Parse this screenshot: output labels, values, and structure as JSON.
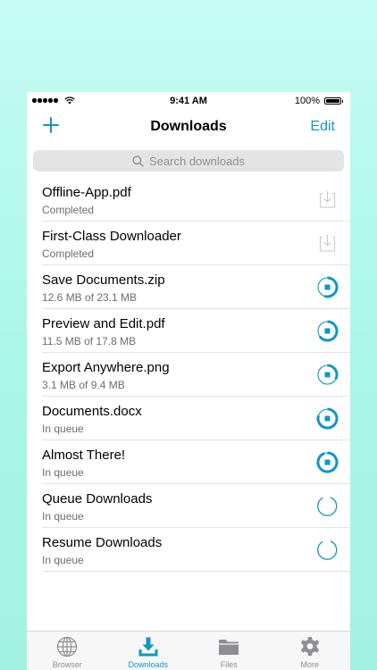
{
  "status": {
    "time": "9:41 AM",
    "battery": "100%"
  },
  "nav": {
    "title": "Downloads",
    "edit": "Edit"
  },
  "search": {
    "placeholder": "Search downloads"
  },
  "accent": "#1396c1",
  "rows": [
    {
      "title": "Offline-App.pdf",
      "subtitle": "Completed",
      "icon": "download-done-icon"
    },
    {
      "title": "First-Class Downloader",
      "subtitle": "Completed",
      "icon": "download-done-icon"
    },
    {
      "title": "Save Documents.zip",
      "subtitle": "12.6 MB of 23.1 MB",
      "icon": "progress-stop-icon",
      "progress": 0.55
    },
    {
      "title": "Preview and Edit.pdf",
      "subtitle": "11.5 MB of 17.8 MB",
      "icon": "progress-stop-icon",
      "progress": 0.65
    },
    {
      "title": "Export Anywhere.png",
      "subtitle": "3.1 MB of 9.4 MB",
      "icon": "progress-stop-icon",
      "progress": 0.33
    },
    {
      "title": "Documents.docx",
      "subtitle": "In queue",
      "icon": "progress-stop-icon",
      "progress": 0.8
    },
    {
      "title": "Almost There!",
      "subtitle": "In queue",
      "icon": "progress-stop-icon",
      "progress": 0.95
    },
    {
      "title": "Queue Downloads",
      "subtitle": "In queue",
      "icon": "loading-spinner-icon"
    },
    {
      "title": "Resume Downloads",
      "subtitle": "In queue",
      "icon": "loading-spinner-icon"
    }
  ],
  "tabs": [
    {
      "label": "Browser",
      "icon": "globe-icon"
    },
    {
      "label": "Downloads",
      "icon": "download-tray-icon",
      "active": true
    },
    {
      "label": "Files",
      "icon": "folder-icon"
    },
    {
      "label": "More",
      "icon": "gear-icon"
    }
  ]
}
